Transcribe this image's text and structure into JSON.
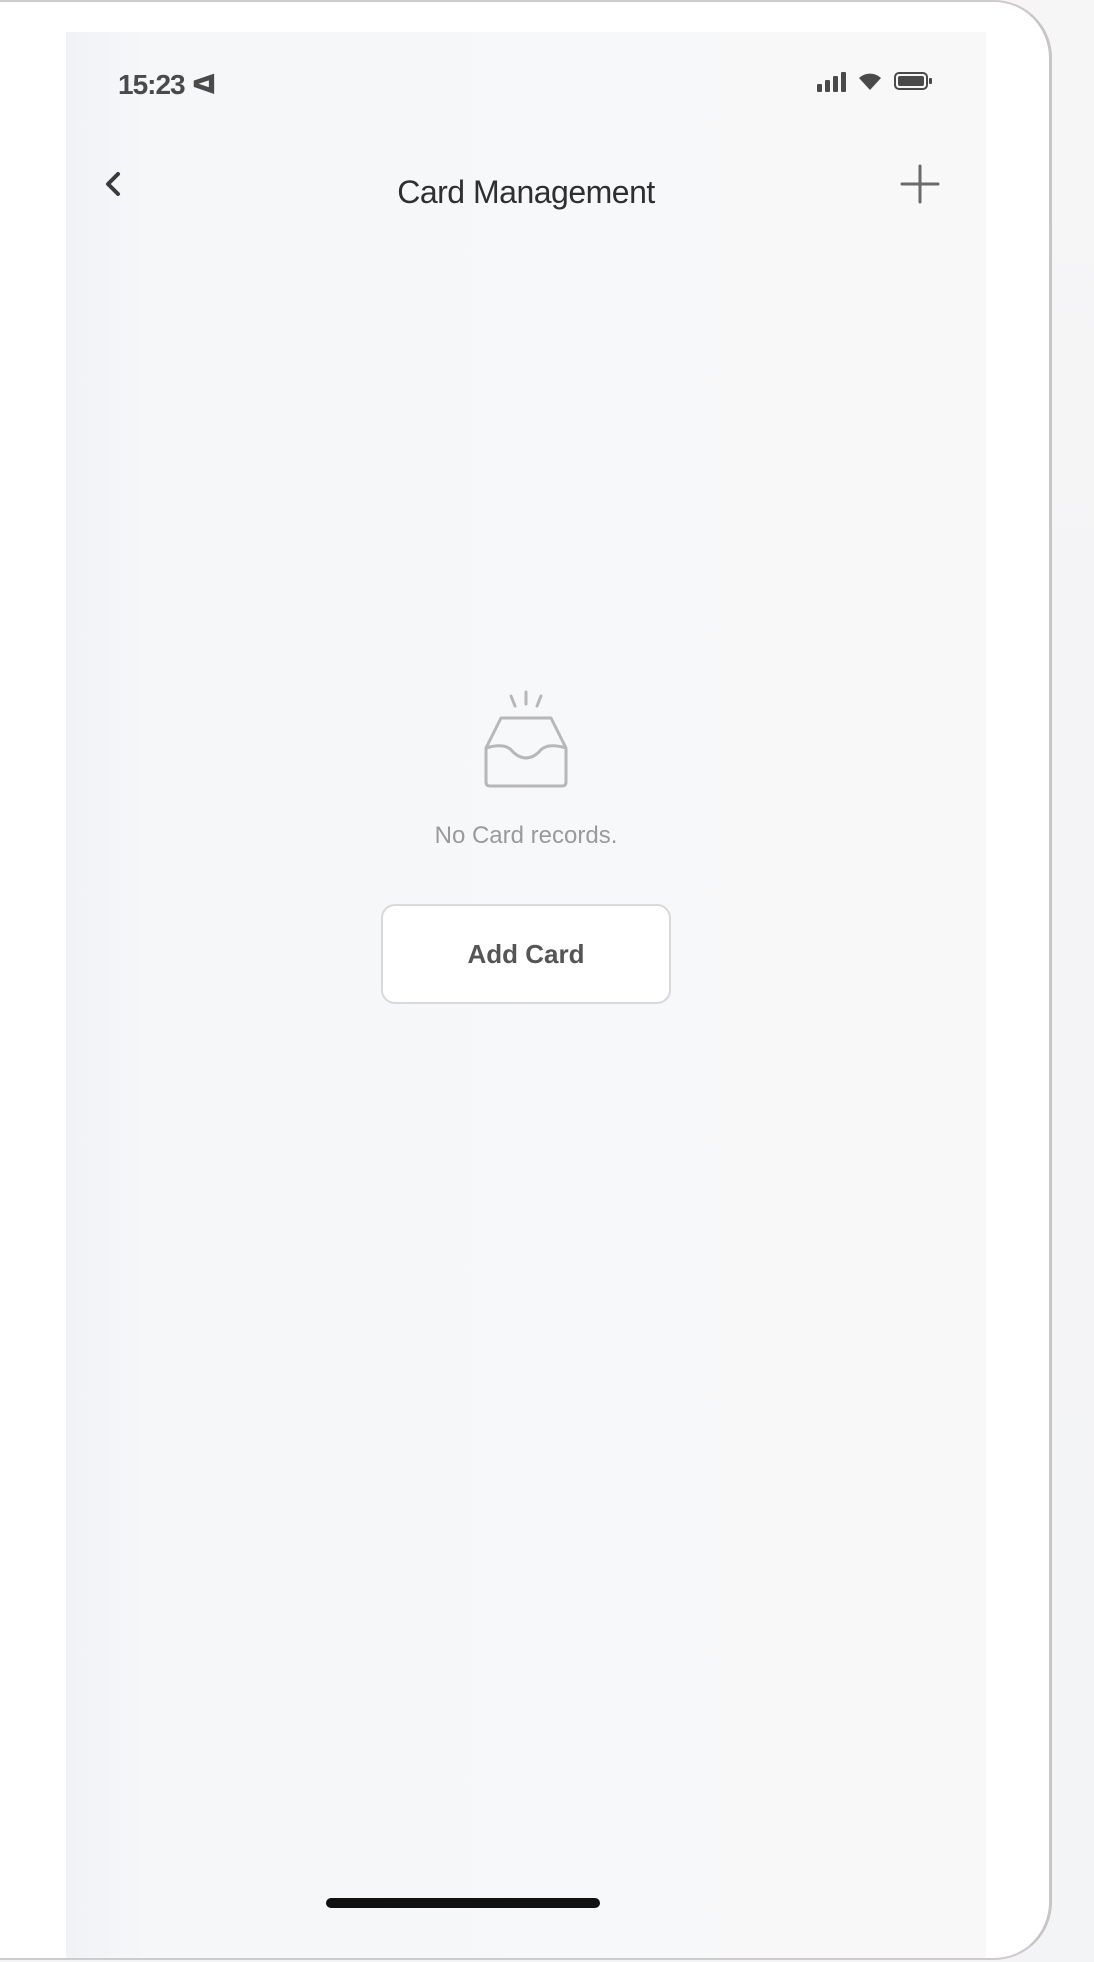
{
  "status_bar": {
    "time": "15:23 ᐊ",
    "icons": [
      "signal-icon",
      "wifi-icon",
      "battery-icon"
    ]
  },
  "nav": {
    "back_icon": "chevron-left-icon",
    "title": "Card Management",
    "add_icon": "plus-icon"
  },
  "empty_state": {
    "icon": "inbox-icon",
    "message": "No Card records.",
    "button_label": "Add Card"
  },
  "colors": {
    "text_primary": "#2f2f2f",
    "text_muted": "#9a9a9a",
    "button_border": "#d9d9d9",
    "home_indicator": "#111111"
  }
}
